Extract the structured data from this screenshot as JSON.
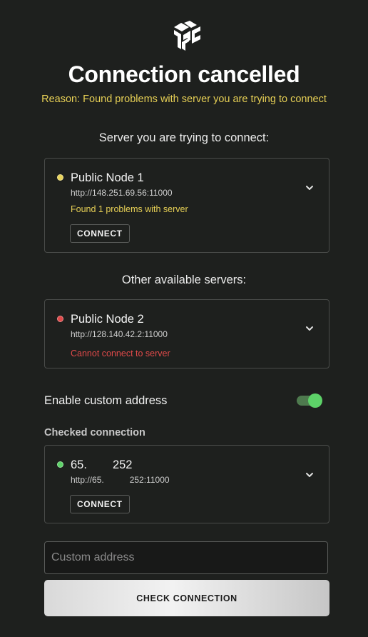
{
  "header": {
    "logo_icon": "app-logo-icon",
    "title": "Connection cancelled",
    "reason": "Reason: Found problems with server you are trying to connect"
  },
  "current_server": {
    "section_title": "Server you are trying to connect:",
    "name": "Public Node 1",
    "url": "http://148.251.69.56:11000",
    "status": "Found 1 problems with server",
    "status_color": "#e6cf55",
    "dot_color": "#e8d35a",
    "connect_label": "CONNECT"
  },
  "other_servers": {
    "section_title": "Other available servers:",
    "items": [
      {
        "name": "Public Node 2",
        "url": "http://128.140.42.2:11000",
        "status": "Cannot connect to server",
        "status_color": "#e04a4a",
        "dot_color": "#e04a4a"
      }
    ]
  },
  "custom_address": {
    "toggle_label": "Enable custom address",
    "toggle_on": true,
    "checked_label": "Checked connection",
    "checked_node": {
      "name_part1": "65.",
      "name_part2": "252",
      "url_part1": "http://65.",
      "url_part2": "252:11000",
      "dot_color": "#5dd268",
      "connect_label": "CONNECT"
    },
    "input_placeholder": "Custom address",
    "check_button_label": "CHECK CONNECTION"
  },
  "colors": {
    "background": "#1e201e",
    "accent_yellow": "#e6cf55",
    "error_red": "#e04a4a",
    "success_green": "#5dd268"
  }
}
